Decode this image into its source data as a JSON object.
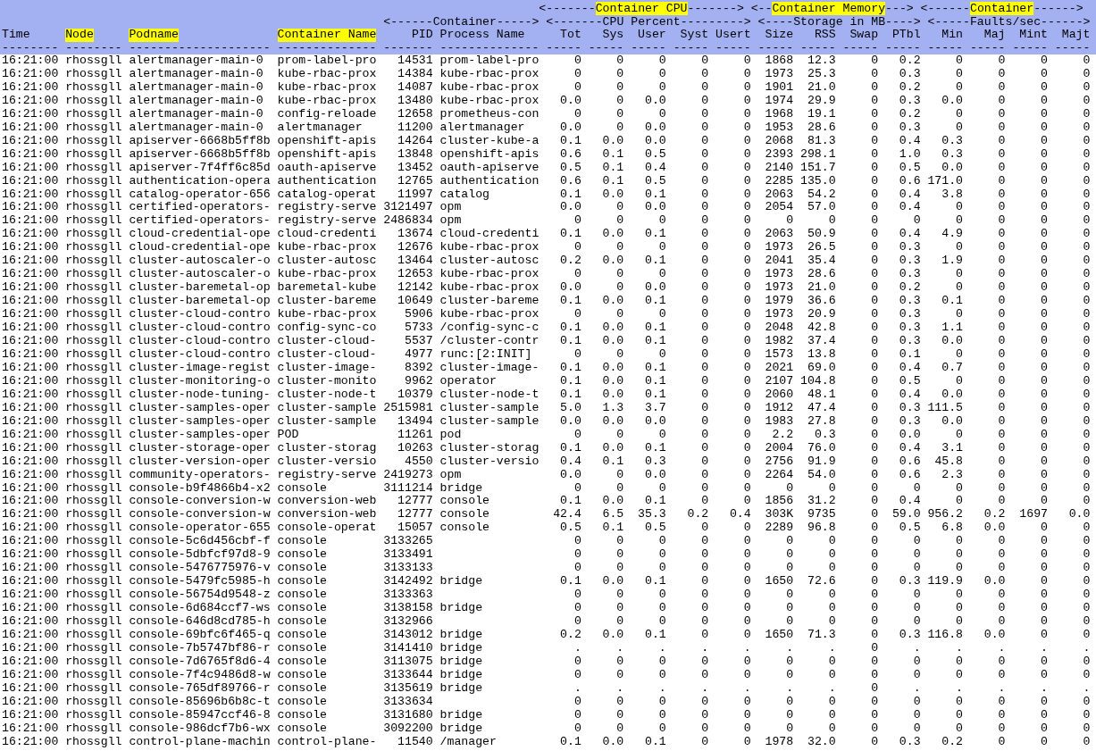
{
  "report": {
    "group_lines": [
      [
        {
          "lead": "<-------",
          "label": "Container CPU",
          "tail": "------->",
          "highlighted": true
        },
        {
          "lead": "<--",
          "label": "Container Memory",
          "tail": "--->",
          "highlighted": true
        },
        {
          "lead": "<------",
          "label": "Container",
          "tail": "------>",
          "highlighted": true
        }
      ],
      [
        {
          "lead": "<------",
          "label": "Container",
          "tail": "----->",
          "highlighted": false
        },
        {
          "lead": "<-------",
          "label": "CPU Percent",
          "tail": "--------->",
          "highlighted": false
        },
        {
          "lead": "<----",
          "label": "Storage in MB",
          "tail": "---->",
          "highlighted": false
        },
        {
          "lead": "<-----",
          "label": "Faults/sec",
          "tail": "------>",
          "highlighted": false
        }
      ]
    ],
    "columns": [
      {
        "label": "Time",
        "highlighted": false,
        "kind": "text",
        "underline": "--------"
      },
      {
        "label": "Node",
        "highlighted": true,
        "kind": "text",
        "underline": "--------"
      },
      {
        "label": "Podname",
        "highlighted": true,
        "kind": "text",
        "underline": "--------------------"
      },
      {
        "label": "Container Name",
        "highlighted": true,
        "kind": "text",
        "underline": "--------------"
      },
      {
        "label": "PID",
        "highlighted": false,
        "kind": "number",
        "underline": "-------"
      },
      {
        "label": "Process Name",
        "highlighted": false,
        "kind": "text",
        "underline": "--------------"
      },
      {
        "label": "Tot",
        "highlighted": false,
        "kind": "number",
        "underline": "-----"
      },
      {
        "label": "Sys",
        "highlighted": false,
        "kind": "number",
        "underline": "-----"
      },
      {
        "label": "User",
        "highlighted": false,
        "kind": "number",
        "underline": "-----"
      },
      {
        "label": "Syst",
        "highlighted": false,
        "kind": "number",
        "underline": "-----"
      },
      {
        "label": "Usert",
        "highlighted": false,
        "kind": "number",
        "underline": "-----"
      },
      {
        "label": "Size",
        "highlighted": false,
        "kind": "number",
        "underline": "-----"
      },
      {
        "label": "RSS",
        "highlighted": false,
        "kind": "number",
        "underline": "-----"
      },
      {
        "label": "Swap",
        "highlighted": false,
        "kind": "number",
        "underline": "-----"
      },
      {
        "label": "PTbl",
        "highlighted": false,
        "kind": "number",
        "underline": "-----"
      },
      {
        "label": "Min",
        "highlighted": false,
        "kind": "number",
        "underline": "-----"
      },
      {
        "label": "Maj",
        "highlighted": false,
        "kind": "number",
        "underline": "-----"
      },
      {
        "label": "Mint",
        "highlighted": false,
        "kind": "number",
        "underline": "-----"
      },
      {
        "label": "Majt",
        "highlighted": false,
        "kind": "number",
        "underline": "-----"
      }
    ],
    "rows": [
      [
        "16:21:00",
        "rhossgll",
        "alertmanager-main-0",
        "prom-label-pro",
        "14531",
        "prom-label-pro",
        "0",
        "0",
        "0",
        "0",
        "0",
        "1868",
        "12.3",
        "0",
        "0.2",
        "0",
        "0",
        "0",
        "0"
      ],
      [
        "16:21:00",
        "rhossgll",
        "alertmanager-main-0",
        "kube-rbac-prox",
        "14384",
        "kube-rbac-prox",
        "0",
        "0",
        "0",
        "0",
        "0",
        "1973",
        "25.3",
        "0",
        "0.3",
        "0",
        "0",
        "0",
        "0"
      ],
      [
        "16:21:00",
        "rhossgll",
        "alertmanager-main-0",
        "kube-rbac-prox",
        "14087",
        "kube-rbac-prox",
        "0",
        "0",
        "0",
        "0",
        "0",
        "1901",
        "21.0",
        "0",
        "0.2",
        "0",
        "0",
        "0",
        "0"
      ],
      [
        "16:21:00",
        "rhossgll",
        "alertmanager-main-0",
        "kube-rbac-prox",
        "13480",
        "kube-rbac-prox",
        "0.0",
        "0",
        "0.0",
        "0",
        "0",
        "1974",
        "29.9",
        "0",
        "0.3",
        "0.0",
        "0",
        "0",
        "0"
      ],
      [
        "16:21:00",
        "rhossgll",
        "alertmanager-main-0",
        "config-reloade",
        "12658",
        "prometheus-con",
        "0",
        "0",
        "0",
        "0",
        "0",
        "1968",
        "19.1",
        "0",
        "0.2",
        "0",
        "0",
        "0",
        "0"
      ],
      [
        "16:21:00",
        "rhossgll",
        "alertmanager-main-0",
        "alertmanager",
        "11200",
        "alertmanager",
        "0.0",
        "0",
        "0.0",
        "0",
        "0",
        "1953",
        "28.6",
        "0",
        "0.3",
        "0",
        "0",
        "0",
        "0"
      ],
      [
        "16:21:00",
        "rhossgll",
        "apiserver-6668b5ff8b",
        "openshift-apis",
        "14264",
        "cluster-kube-a",
        "0.1",
        "0.0",
        "0.0",
        "0",
        "0",
        "2068",
        "81.3",
        "0",
        "0.4",
        "0.3",
        "0",
        "0",
        "0"
      ],
      [
        "16:21:00",
        "rhossgll",
        "apiserver-6668b5ff8b",
        "openshift-apis",
        "13848",
        "openshift-apis",
        "0.6",
        "0.1",
        "0.5",
        "0",
        "0",
        "2393",
        "298.1",
        "0",
        "1.0",
        "0.3",
        "0",
        "0",
        "0"
      ],
      [
        "16:21:00",
        "rhossgll",
        "apiserver-7f4ff6c85d",
        "oauth-apiserve",
        "13452",
        "oauth-apiserve",
        "0.5",
        "0.1",
        "0.4",
        "0",
        "0",
        "2140",
        "151.7",
        "0",
        "0.5",
        "0.0",
        "0",
        "0",
        "0"
      ],
      [
        "16:21:00",
        "rhossgll",
        "authentication-opera",
        "authentication",
        "12765",
        "authentication",
        "0.6",
        "0.1",
        "0.5",
        "0",
        "0",
        "2285",
        "135.0",
        "0",
        "0.6",
        "171.0",
        "0",
        "0",
        "0"
      ],
      [
        "16:21:00",
        "rhossgll",
        "catalog-operator-656",
        "catalog-operat",
        "11997",
        "catalog",
        "0.1",
        "0.0",
        "0.1",
        "0",
        "0",
        "2063",
        "54.2",
        "0",
        "0.4",
        "3.8",
        "0",
        "0",
        "0"
      ],
      [
        "16:21:00",
        "rhossgll",
        "certified-operators-",
        "registry-serve",
        "3121497",
        "opm",
        "0.0",
        "0",
        "0.0",
        "0",
        "0",
        "2054",
        "57.0",
        "0",
        "0.4",
        "0",
        "0",
        "0",
        "0"
      ],
      [
        "16:21:00",
        "rhossgll",
        "certified-operators-",
        "registry-serve",
        "2486834",
        "opm",
        "0",
        "0",
        "0",
        "0",
        "0",
        "0",
        "0",
        "0",
        "0",
        "0",
        "0",
        "0",
        "0"
      ],
      [
        "16:21:00",
        "rhossgll",
        "cloud-credential-ope",
        "cloud-credenti",
        "13674",
        "cloud-credenti",
        "0.1",
        "0.0",
        "0.1",
        "0",
        "0",
        "2063",
        "50.9",
        "0",
        "0.4",
        "4.9",
        "0",
        "0",
        "0"
      ],
      [
        "16:21:00",
        "rhossgll",
        "cloud-credential-ope",
        "kube-rbac-prox",
        "12676",
        "kube-rbac-prox",
        "0",
        "0",
        "0",
        "0",
        "0",
        "1973",
        "26.5",
        "0",
        "0.3",
        "0",
        "0",
        "0",
        "0"
      ],
      [
        "16:21:00",
        "rhossgll",
        "cluster-autoscaler-o",
        "cluster-autosc",
        "13464",
        "cluster-autosc",
        "0.2",
        "0.0",
        "0.1",
        "0",
        "0",
        "2041",
        "35.4",
        "0",
        "0.3",
        "1.9",
        "0",
        "0",
        "0"
      ],
      [
        "16:21:00",
        "rhossgll",
        "cluster-autoscaler-o",
        "kube-rbac-prox",
        "12653",
        "kube-rbac-prox",
        "0",
        "0",
        "0",
        "0",
        "0",
        "1973",
        "28.6",
        "0",
        "0.3",
        "0",
        "0",
        "0",
        "0"
      ],
      [
        "16:21:00",
        "rhossgll",
        "cluster-baremetal-op",
        "baremetal-kube",
        "12142",
        "kube-rbac-prox",
        "0.0",
        "0",
        "0.0",
        "0",
        "0",
        "1973",
        "21.0",
        "0",
        "0.2",
        "0",
        "0",
        "0",
        "0"
      ],
      [
        "16:21:00",
        "rhossgll",
        "cluster-baremetal-op",
        "cluster-bareme",
        "10649",
        "cluster-bareme",
        "0.1",
        "0.0",
        "0.1",
        "0",
        "0",
        "1979",
        "36.6",
        "0",
        "0.3",
        "0.1",
        "0",
        "0",
        "0"
      ],
      [
        "16:21:00",
        "rhossgll",
        "cluster-cloud-contro",
        "kube-rbac-prox",
        "5906",
        "kube-rbac-prox",
        "0",
        "0",
        "0",
        "0",
        "0",
        "1973",
        "20.9",
        "0",
        "0.3",
        "0",
        "0",
        "0",
        "0"
      ],
      [
        "16:21:00",
        "rhossgll",
        "cluster-cloud-contro",
        "config-sync-co",
        "5733",
        "/config-sync-c",
        "0.1",
        "0.0",
        "0.1",
        "0",
        "0",
        "2048",
        "42.8",
        "0",
        "0.3",
        "1.1",
        "0",
        "0",
        "0"
      ],
      [
        "16:21:00",
        "rhossgll",
        "cluster-cloud-contro",
        "cluster-cloud-",
        "5537",
        "/cluster-contr",
        "0.1",
        "0.0",
        "0.1",
        "0",
        "0",
        "1982",
        "37.4",
        "0",
        "0.3",
        "0.0",
        "0",
        "0",
        "0"
      ],
      [
        "16:21:00",
        "rhossgll",
        "cluster-cloud-contro",
        "cluster-cloud-",
        "4977",
        "runc:[2:INIT]",
        "0",
        "0",
        "0",
        "0",
        "0",
        "1573",
        "13.8",
        "0",
        "0.1",
        "0",
        "0",
        "0",
        "0"
      ],
      [
        "16:21:00",
        "rhossgll",
        "cluster-image-regist",
        "cluster-image-",
        "8392",
        "cluster-image-",
        "0.1",
        "0.0",
        "0.1",
        "0",
        "0",
        "2021",
        "69.0",
        "0",
        "0.4",
        "0.7",
        "0",
        "0",
        "0"
      ],
      [
        "16:21:00",
        "rhossgll",
        "cluster-monitoring-o",
        "cluster-monito",
        "9962",
        "operator",
        "0.1",
        "0.0",
        "0.1",
        "0",
        "0",
        "2107",
        "104.8",
        "0",
        "0.5",
        "0",
        "0",
        "0",
        "0"
      ],
      [
        "16:21:00",
        "rhossgll",
        "cluster-node-tuning-",
        "cluster-node-t",
        "10379",
        "cluster-node-t",
        "0.1",
        "0.0",
        "0.1",
        "0",
        "0",
        "2060",
        "48.1",
        "0",
        "0.4",
        "0.0",
        "0",
        "0",
        "0"
      ],
      [
        "16:21:00",
        "rhossgll",
        "cluster-samples-oper",
        "cluster-sample",
        "2515981",
        "cluster-sample",
        "5.0",
        "1.3",
        "3.7",
        "0",
        "0",
        "1912",
        "47.4",
        "0",
        "0.3",
        "111.5",
        "0",
        "0",
        "0"
      ],
      [
        "16:21:00",
        "rhossgll",
        "cluster-samples-oper",
        "cluster-sample",
        "13494",
        "cluster-sample",
        "0.0",
        "0.0",
        "0.0",
        "0",
        "0",
        "1983",
        "27.8",
        "0",
        "0.3",
        "0.0",
        "0",
        "0",
        "0"
      ],
      [
        "16:21:00",
        "rhossgll",
        "cluster-samples-oper",
        "POD",
        "11261",
        "pod",
        "0",
        "0",
        "0",
        "0",
        "0",
        "2.2",
        "0.3",
        "0",
        "0.0",
        "0",
        "0",
        "0",
        "0"
      ],
      [
        "16:21:00",
        "rhossgll",
        "cluster-storage-oper",
        "cluster-storag",
        "10263",
        "cluster-storag",
        "0.1",
        "0.0",
        "0.1",
        "0",
        "0",
        "2004",
        "76.0",
        "0",
        "0.4",
        "3.1",
        "0",
        "0",
        "0"
      ],
      [
        "16:21:00",
        "rhossgll",
        "cluster-version-oper",
        "cluster-versio",
        "4550",
        "cluster-versio",
        "0.4",
        "0.1",
        "0.3",
        "0",
        "0",
        "2756",
        "91.9",
        "0",
        "0.6",
        "45.8",
        "0",
        "0",
        "0"
      ],
      [
        "16:21:00",
        "rhossgll",
        "community-operators-",
        "registry-serve",
        "2419273",
        "opm",
        "0.0",
        "0",
        "0.0",
        "0",
        "0",
        "2264",
        "54.0",
        "0",
        "0.6",
        "2.3",
        "0",
        "0",
        "0"
      ],
      [
        "16:21:00",
        "rhossgll",
        "console-b9f4866b4-x2",
        "console",
        "3111214",
        "bridge",
        "0",
        "0",
        "0",
        "0",
        "0",
        "0",
        "0",
        "0",
        "0",
        "0",
        "0",
        "0",
        "0"
      ],
      [
        "16:21:00",
        "rhossgll",
        "console-conversion-w",
        "conversion-web",
        "12777",
        "console",
        "0.1",
        "0.0",
        "0.1",
        "0",
        "0",
        "1856",
        "31.2",
        "0",
        "0.4",
        "0",
        "0",
        "0",
        "0"
      ],
      [
        "16:21:00",
        "rhossgll",
        "console-conversion-w",
        "conversion-web",
        "12777",
        "console",
        "42.4",
        "6.5",
        "35.3",
        "0.2",
        "0.4",
        "303K",
        "9735",
        "0",
        "59.0",
        "956.2",
        "0.2",
        "1697",
        "0.0"
      ],
      [
        "16:21:00",
        "rhossgll",
        "console-operator-655",
        "console-operat",
        "15057",
        "console",
        "0.5",
        "0.1",
        "0.5",
        "0",
        "0",
        "2289",
        "96.8",
        "0",
        "0.5",
        "6.8",
        "0.0",
        "0",
        "0"
      ],
      [
        "16:21:00",
        "rhossgll",
        "console-5c6d456cbf-f",
        "console",
        "3133265",
        null,
        "0",
        "0",
        "0",
        "0",
        "0",
        "0",
        "0",
        "0",
        "0",
        "0",
        "0",
        "0",
        "0"
      ],
      [
        "16:21:00",
        "rhossgll",
        "console-5dbfcf97d8-9",
        "console",
        "3133491",
        null,
        "0",
        "0",
        "0",
        "0",
        "0",
        "0",
        "0",
        "0",
        "0",
        "0",
        "0",
        "0",
        "0"
      ],
      [
        "16:21:00",
        "rhossgll",
        "console-5476775976-v",
        "console",
        "3133133",
        null,
        "0",
        "0",
        "0",
        "0",
        "0",
        "0",
        "0",
        "0",
        "0",
        "0",
        "0",
        "0",
        "0"
      ],
      [
        "16:21:00",
        "rhossgll",
        "console-5479fc5985-h",
        "console",
        "3142492",
        "bridge",
        "0.1",
        "0.0",
        "0.1",
        "0",
        "0",
        "1650",
        "72.6",
        "0",
        "0.3",
        "119.9",
        "0.0",
        "0",
        "0"
      ],
      [
        "16:21:00",
        "rhossgll",
        "console-56754d9548-z",
        "console",
        "3133363",
        null,
        "0",
        "0",
        "0",
        "0",
        "0",
        "0",
        "0",
        "0",
        "0",
        "0",
        "0",
        "0",
        "0"
      ],
      [
        "16:21:00",
        "rhossgll",
        "console-6d684ccf7-ws",
        "console",
        "3138158",
        "bridge",
        "0",
        "0",
        "0",
        "0",
        "0",
        "0",
        "0",
        "0",
        "0",
        "0",
        "0",
        "0",
        "0"
      ],
      [
        "16:21:00",
        "rhossgll",
        "console-646d8cd785-h",
        "console",
        "3132966",
        null,
        "0",
        "0",
        "0",
        "0",
        "0",
        "0",
        "0",
        "0",
        "0",
        "0",
        "0",
        "0",
        "0"
      ],
      [
        "16:21:00",
        "rhossgll",
        "console-69bfc6f465-q",
        "console",
        "3143012",
        "bridge",
        "0.2",
        "0.0",
        "0.1",
        "0",
        "0",
        "1650",
        "71.3",
        "0",
        "0.3",
        "116.8",
        "0.0",
        "0",
        "0"
      ],
      [
        "16:21:00",
        "rhossgll",
        "console-7b5747bf86-r",
        "console",
        "3141410",
        "bridge",
        ".",
        ".",
        ".",
        ".",
        ".",
        ".",
        ".",
        "0",
        ".",
        ".",
        ".",
        ".",
        "."
      ],
      [
        "16:21:00",
        "rhossgll",
        "console-7d6765f8d6-4",
        "console",
        "3113075",
        "bridge",
        "0",
        "0",
        "0",
        "0",
        "0",
        "0",
        "0",
        "0",
        "0",
        "0",
        "0",
        "0",
        "0"
      ],
      [
        "16:21:00",
        "rhossgll",
        "console-7f4c9486d8-w",
        "console",
        "3133644",
        "bridge",
        "0",
        "0",
        "0",
        "0",
        "0",
        "0",
        "0",
        "0",
        "0",
        "0",
        "0",
        "0",
        "0"
      ],
      [
        "16:21:00",
        "rhossgll",
        "console-765df89766-r",
        "console",
        "3135619",
        "bridge",
        ".",
        ".",
        ".",
        ".",
        ".",
        ".",
        ".",
        "0",
        ".",
        ".",
        ".",
        ".",
        "."
      ],
      [
        "16:21:00",
        "rhossgll",
        "console-85696b6b8c-t",
        "console",
        "3133634",
        null,
        "0",
        "0",
        "0",
        "0",
        "0",
        "0",
        "0",
        "0",
        "0",
        "0",
        "0",
        "0",
        "0"
      ],
      [
        "16:21:00",
        "rhossgll",
        "console-85947ccf46-8",
        "console",
        "3131680",
        "bridge",
        "0",
        "0",
        "0",
        "0",
        "0",
        "0",
        "0",
        "0",
        "0",
        "0",
        "0",
        "0",
        "0"
      ],
      [
        "16:21:00",
        "rhossgll",
        "console-986dcf7b6-wx",
        "console",
        "3092200",
        "bridge",
        "0",
        "0",
        "0",
        "0",
        "0",
        "0",
        "0",
        "0",
        "0",
        "0",
        "0",
        "0",
        "0"
      ],
      [
        "16:21:00",
        "rhossgll",
        "control-plane-machin",
        "control-plane-",
        "11540",
        "/manager",
        "0.1",
        "0.0",
        "0.1",
        "0",
        "0",
        "1978",
        "32.0",
        "0",
        "0.3",
        "0.2",
        "0",
        "0",
        "0"
      ]
    ]
  }
}
